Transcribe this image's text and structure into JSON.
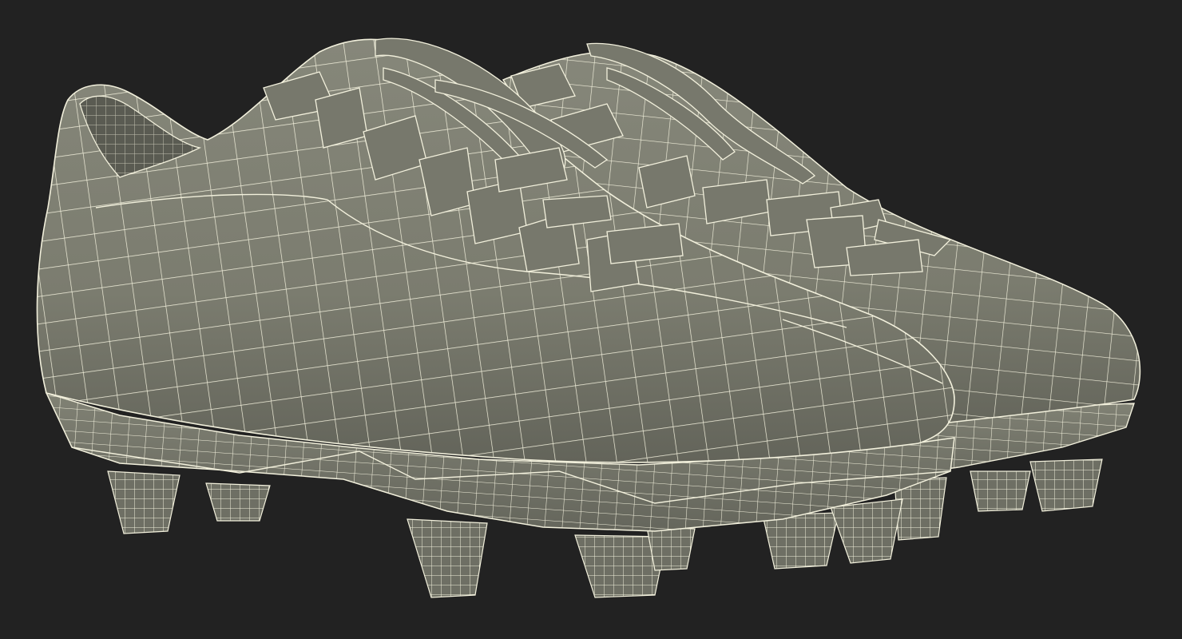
{
  "scene": {
    "background_color": "#222222",
    "surface_color": "#7c7d70",
    "surface_dark": "#5f6057",
    "surface_light": "#8a8b7e",
    "wire_color": "#f2f0dc",
    "subject": "pair-of-football-cleats-wireframe-render"
  }
}
